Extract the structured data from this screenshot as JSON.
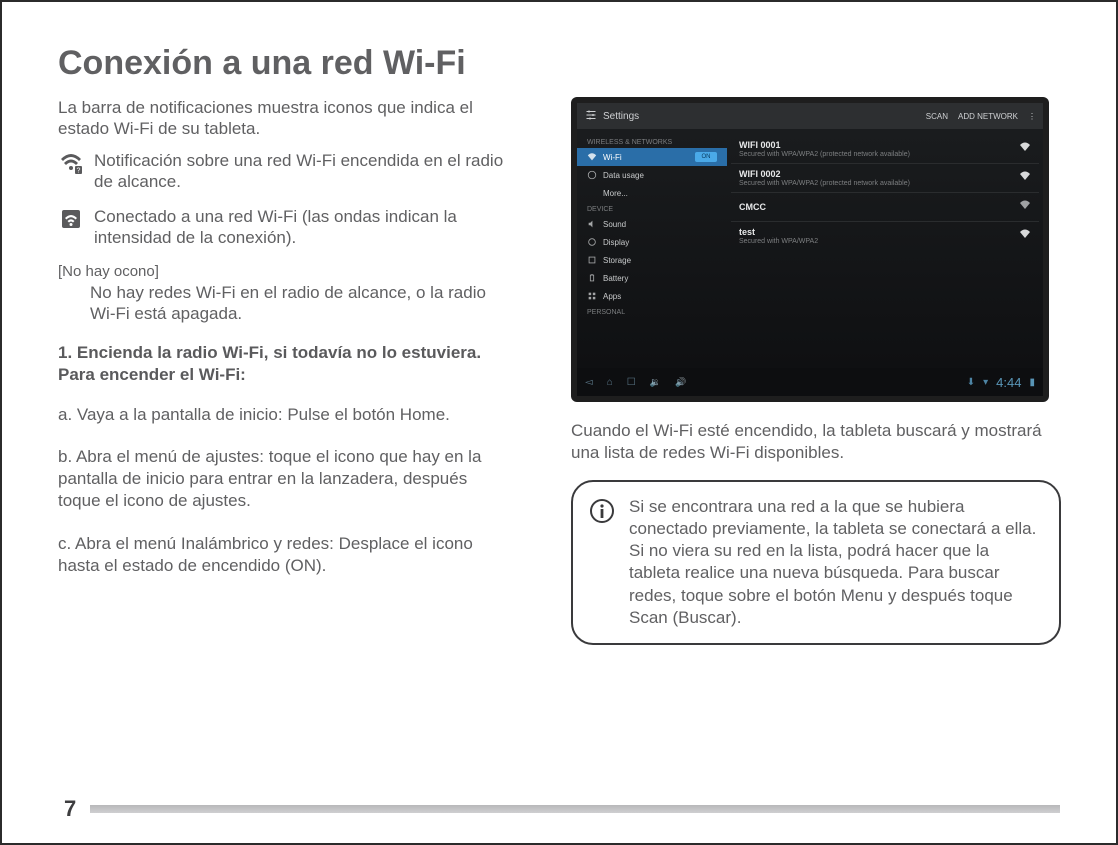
{
  "title": "Conexión a una red Wi-Fi",
  "intro": "La barra de notificaciones muestra iconos que indica el estado Wi-Fi de su tableta.",
  "icon_items": {
    "in_range": "Notificación sobre una red Wi-Fi encendida en el radio de alcance.",
    "connected": "Conectado a una red Wi-Fi (las ondas indican la intensidad de la conexión)."
  },
  "no_icon_label": "[No hay ocono]",
  "no_icon_text": "No hay redes Wi-Fi en el radio de alcance, o la radio Wi-Fi está apagada.",
  "step_heading": "1. Encienda la radio Wi-Fi, si todavía no lo estuviera. Para encender el Wi-Fi:",
  "steps": {
    "a": "a. Vaya a la pantalla de inicio: Pulse el botón Home.",
    "b": "b. Abra el menú de ajustes: toque el icono que hay en la pantalla de inicio para entrar en la lanzadera, después toque el icono de ajustes.",
    "c": "c. Abra el menú Inalámbrico y redes: Desplace el icono hasta el estado de encendido (ON)."
  },
  "screenshot": {
    "settings_label": "Settings",
    "top_actions": {
      "scan": "SCAN",
      "add": "ADD NETWORK"
    },
    "sections": {
      "wireless": "WIRELESS & NETWORKS",
      "device": "DEVICE",
      "personal": "PERSONAL"
    },
    "sidebar": {
      "wifi": "Wi-Fi",
      "wifi_toggle": "ON",
      "data": "Data usage",
      "more": "More...",
      "sound": "Sound",
      "display": "Display",
      "storage": "Storage",
      "battery": "Battery",
      "apps": "Apps"
    },
    "networks": [
      {
        "name": "WIFI 0001",
        "sub": "Secured with WPA/WPA2 (protected network available)"
      },
      {
        "name": "WIFI 0002",
        "sub": "Secured with WPA/WPA2 (protected network available)"
      },
      {
        "name": "CMCC",
        "sub": ""
      },
      {
        "name": "test",
        "sub": "Secured with WPA/WPA2"
      }
    ],
    "clock": "4:44"
  },
  "right_paragraph": "Cuando el Wi-Fi esté encendido, la tableta buscará y mostrará una lista de redes Wi-Fi disponibles.",
  "info_box": {
    "p1": "Si se encontrara una red a la que se hubiera conectado previamente, la tableta se conectará a ella.",
    "p2": "Si no viera su red en la lista, podrá hacer que la tableta realice  una nueva búsqueda. Para buscar redes, toque sobre el botón Menu y después toque Scan (Buscar)."
  },
  "page_number": "7"
}
